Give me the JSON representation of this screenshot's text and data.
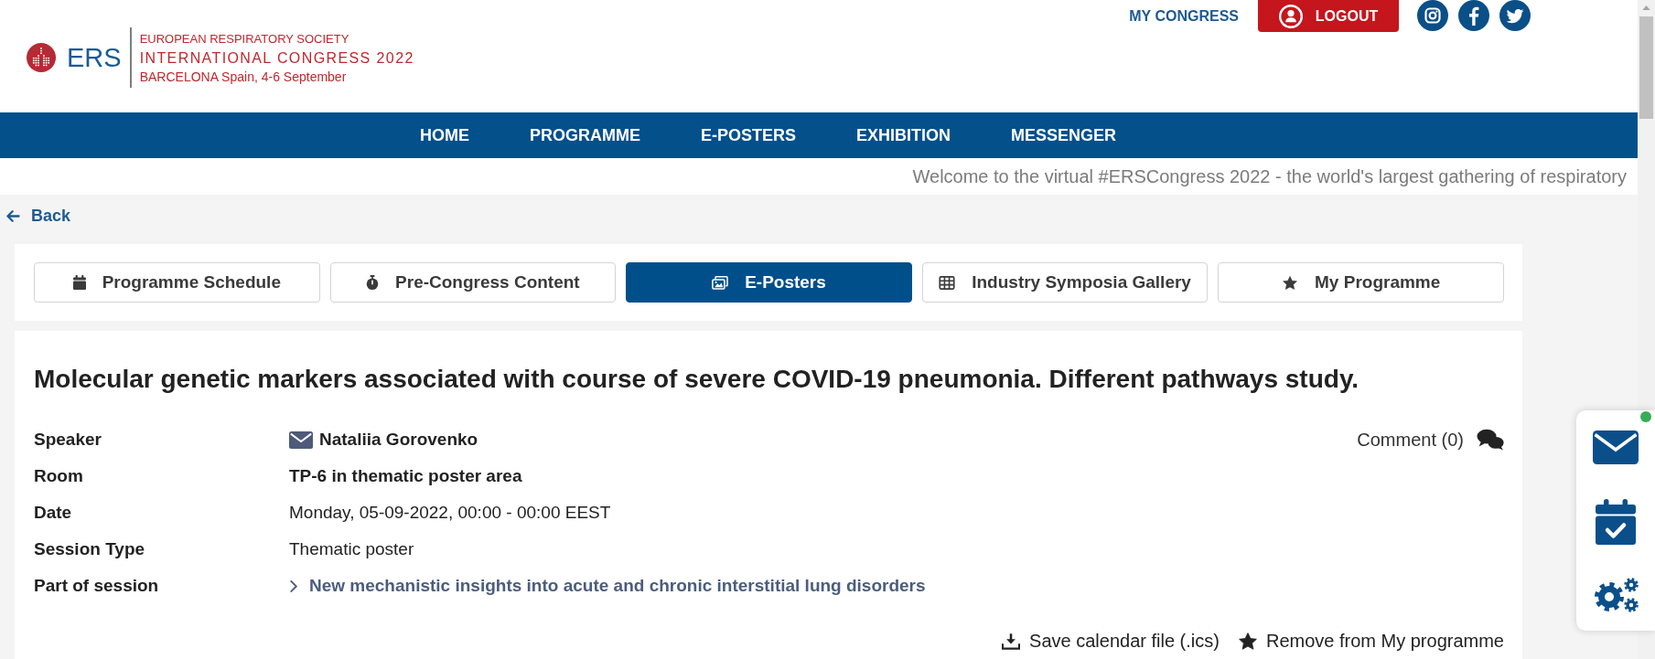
{
  "header": {
    "logo": {
      "mark": "ERS",
      "society": "EUROPEAN RESPIRATORY SOCIETY",
      "congress": "INTERNATIONAL CONGRESS 2022",
      "location": "BARCELONA Spain, 4-6 September"
    },
    "my_congress": "MY CONGRESS",
    "logout": "LOGOUT"
  },
  "nav": [
    {
      "label": "HOME",
      "selected": false
    },
    {
      "label": "PROGRAMME",
      "selected": false
    },
    {
      "label": "E-POSTERS",
      "selected": false
    },
    {
      "label": "EXHIBITION",
      "selected": false
    },
    {
      "label": "MESSENGER",
      "selected": false
    }
  ],
  "ticker": "Welcome to the virtual #ERSCongress 2022 - the world's largest gathering of respiratory",
  "back": "Back",
  "tabs": [
    {
      "label": "Programme Schedule",
      "selected": false
    },
    {
      "label": "Pre-Congress Content",
      "selected": false
    },
    {
      "label": "E-Posters",
      "selected": true
    },
    {
      "label": "Industry Symposia Gallery",
      "selected": false
    },
    {
      "label": "My Programme",
      "selected": false
    }
  ],
  "session": {
    "title": "Molecular genetic markers associated with course of severe COVID-19 pneumonia. Different pathways study.",
    "comment": "Comment (0)",
    "details": [
      {
        "label": "Speaker",
        "value": "Nataliia Gorovenko",
        "kind": "speaker"
      },
      {
        "label": "Room",
        "value": "TP-6 in thematic poster area",
        "kind": "strong"
      },
      {
        "label": "Date",
        "value": "Monday, 05-09-2022, 00:00 - 00:00 EEST",
        "kind": "plain"
      },
      {
        "label": "Session Type",
        "value": "Thematic poster",
        "kind": "plain"
      },
      {
        "label": "Part of session",
        "value": "New mechanistic insights into acute and chronic interstitial lung disorders",
        "kind": "link"
      }
    ],
    "actions": [
      "Save calendar file (.ics)",
      "Remove from My programme"
    ]
  },
  "side_panel": {
    "online": true
  }
}
